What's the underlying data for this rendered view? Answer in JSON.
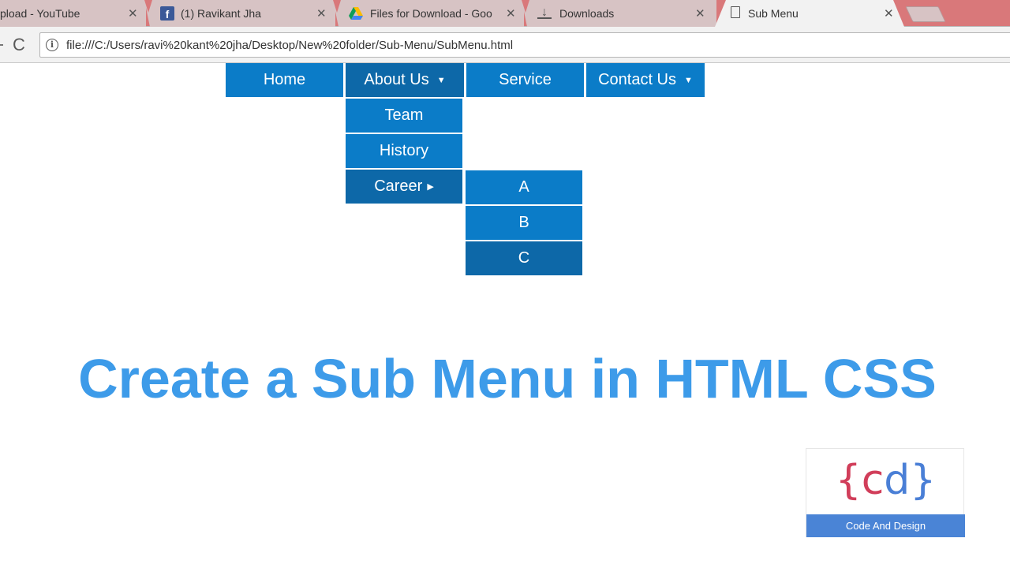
{
  "browser": {
    "tabs": [
      {
        "title": "pload - YouTube",
        "icon": "youtube-icon",
        "active": false
      },
      {
        "title": "(1) Ravikant Jha",
        "icon": "facebook-icon",
        "active": false
      },
      {
        "title": "Files for Download - Goo",
        "icon": "google-drive-icon",
        "active": false
      },
      {
        "title": "Downloads",
        "icon": "download-icon",
        "active": false
      },
      {
        "title": "Sub Menu",
        "icon": "page-icon",
        "active": true
      }
    ],
    "close_glyph": "✕",
    "reload_glyph": "C",
    "info_glyph": "i",
    "url": "file:///C:/Users/ravi%20kant%20jha/Desktop/New%20folder/Sub-Menu/SubMenu.html"
  },
  "nav": {
    "items": [
      {
        "label": "Home",
        "has_dropdown": false
      },
      {
        "label": "About Us",
        "has_dropdown": true
      },
      {
        "label": "Service",
        "has_dropdown": false
      },
      {
        "label": "Contact Us",
        "has_dropdown": true
      }
    ],
    "caret_down": "▼",
    "caret_right": "▶"
  },
  "about_submenu": {
    "items": [
      {
        "label": "Team"
      },
      {
        "label": "History"
      },
      {
        "label": "Career",
        "has_submenu": true
      }
    ]
  },
  "career_submenu": {
    "items": [
      {
        "label": "A"
      },
      {
        "label": "B"
      },
      {
        "label": "C"
      }
    ]
  },
  "headline": "Create a Sub Menu in HTML CSS",
  "logo": {
    "open_brace": "{",
    "c": "c",
    "d": "d",
    "close_brace": "}",
    "caption": "Code And Design"
  },
  "colors": {
    "menu": "#0b7cc8",
    "menu_hover": "#0d68a8",
    "headline": "#3d9be9",
    "logo_red": "#d13e5a",
    "logo_blue": "#4a84d6",
    "tabstrip": "#d9787a"
  }
}
